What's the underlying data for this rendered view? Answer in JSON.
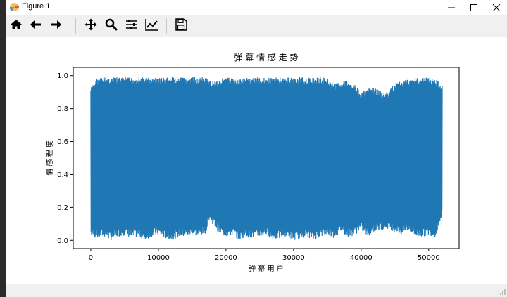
{
  "window": {
    "title": "Figure 1"
  },
  "window_controls": {
    "minimize": "minimize-icon",
    "maximize": "maximize-icon",
    "close": "close-icon"
  },
  "toolbar": {
    "tools": [
      {
        "name": "home-button",
        "icon": "home-icon"
      },
      {
        "name": "back-button",
        "icon": "arrow-left-icon"
      },
      {
        "name": "forward-button",
        "icon": "arrow-right-icon"
      },
      {
        "name": "pan-button",
        "icon": "move-icon"
      },
      {
        "name": "zoom-button",
        "icon": "magnifier-icon"
      },
      {
        "name": "configure-subplots-button",
        "icon": "sliders-icon"
      },
      {
        "name": "edit-axis-button",
        "icon": "line-chart-icon"
      },
      {
        "name": "save-button",
        "icon": "floppy-disk-icon"
      }
    ]
  },
  "chart_data": {
    "type": "line",
    "title": "弹 幕 情 感 走 势",
    "xlabel": "弹 幕 用 户",
    "ylabel": "情 感 程 度",
    "xlim": [
      -2600,
      54500
    ],
    "ylim": [
      -0.05,
      1.05
    ],
    "xticks": [
      0,
      10000,
      20000,
      30000,
      40000,
      50000
    ],
    "xtick_labels": [
      "0",
      "10000",
      "20000",
      "30000",
      "40000",
      "50000"
    ],
    "yticks": [
      0.0,
      0.2,
      0.4,
      0.6,
      0.8,
      1.0
    ],
    "ytick_labels": [
      "0.0",
      "0.2",
      "0.4",
      "0.6",
      "0.8",
      "1.0"
    ],
    "grid": false,
    "color": "#1f77b4",
    "series": [
      {
        "x": [
          0,
          1000,
          2000,
          3000,
          4000,
          5000,
          6000,
          7000,
          8000,
          9000,
          10000,
          11000,
          12000,
          13000,
          14000,
          15000,
          16000,
          17000,
          17500,
          18000,
          19000,
          20000,
          21000,
          22000,
          23000,
          24000,
          25000,
          26000,
          27000,
          28000,
          29000,
          30000,
          31000,
          32000,
          33000,
          34000,
          35000,
          36000,
          37000,
          38000,
          39000,
          40000,
          41000,
          42000,
          43000,
          44000,
          45000,
          46000,
          47000,
          48000,
          49000,
          50000,
          51000,
          52000
        ],
        "max": [
          0.93,
          0.99,
          0.99,
          0.99,
          0.99,
          0.99,
          0.99,
          0.99,
          0.99,
          0.99,
          0.99,
          0.99,
          0.99,
          0.99,
          0.99,
          0.99,
          0.99,
          0.99,
          0.97,
          0.97,
          0.98,
          0.99,
          0.99,
          0.98,
          0.99,
          0.99,
          0.99,
          0.99,
          0.99,
          0.99,
          0.99,
          0.99,
          0.99,
          0.99,
          0.99,
          0.99,
          0.99,
          0.95,
          0.97,
          0.97,
          0.95,
          0.9,
          0.92,
          0.93,
          0.9,
          0.9,
          0.96,
          0.97,
          0.98,
          0.99,
          0.99,
          0.99,
          0.98,
          0.95
        ],
        "min": [
          0.02,
          0.01,
          0.02,
          0.0,
          0.02,
          0.03,
          0.01,
          0.02,
          0.0,
          0.02,
          0.03,
          0.01,
          0.0,
          0.02,
          0.02,
          0.03,
          0.02,
          0.04,
          0.12,
          0.1,
          0.04,
          0.02,
          0.03,
          0.0,
          0.02,
          0.01,
          0.02,
          0.03,
          0.0,
          0.01,
          0.02,
          0.0,
          0.01,
          0.02,
          0.0,
          0.02,
          0.03,
          0.01,
          0.05,
          0.02,
          0.03,
          0.06,
          0.02,
          0.05,
          0.06,
          0.07,
          0.05,
          0.03,
          0.06,
          0.02,
          0.02,
          0.03,
          0.02,
          0.14
        ]
      }
    ]
  }
}
